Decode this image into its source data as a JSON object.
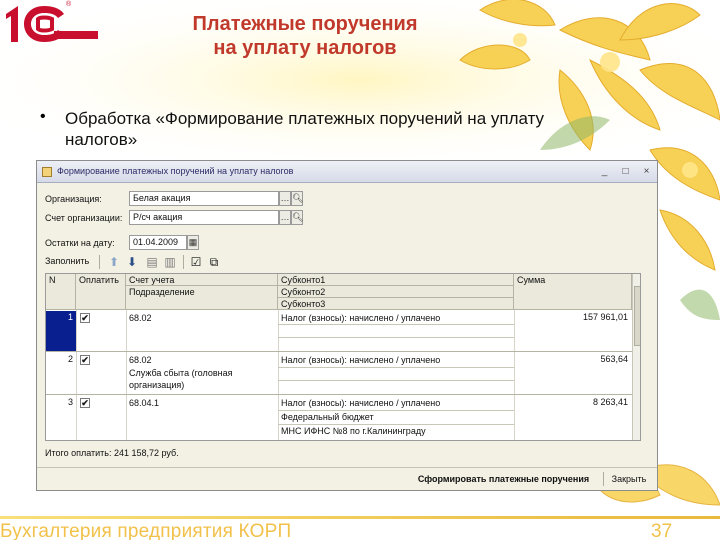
{
  "slide": {
    "title_line1": "Платежные поручения",
    "title_line2": "на уплату налогов",
    "bullet": "Обработка «Формирование платежных поручений на уплату налогов»",
    "footer": "Бухгалтерия предприятия КОРП",
    "page_number": "37",
    "logo_text": "1С",
    "logo_mark": "®"
  },
  "window": {
    "title": "Формирование платежных поручений на уплату налогов",
    "controls": [
      "_",
      "□",
      "×"
    ],
    "organization_label": "Организация:",
    "organization_value": "Белая акация",
    "account_label": "Счет организации:",
    "account_value": "Р/сч акация",
    "balance_label": "Остатки на дату:",
    "balance_value": "01.04.2009",
    "fill_button": "Заполнить",
    "columns": {
      "n": "N",
      "pay": "Оплатить",
      "account": "Счет учета",
      "division": "Подразделение",
      "sub1": "Субконто1",
      "sub2": "Субконто2",
      "sub3": "Субконто3",
      "sum": "Сумма"
    },
    "rows": [
      {
        "n": "1",
        "checked": true,
        "account": "68.02",
        "division": "",
        "sub1": "Налог (взносы): начислено / уплачено",
        "sub2": "",
        "sub3": "",
        "sum": "157 961,01"
      },
      {
        "n": "2",
        "checked": true,
        "account": "68.02",
        "division": "Служба сбыта (головная организация)",
        "sub1": "Налог (взносы): начислено / уплачено",
        "sub2": "",
        "sub3": "",
        "sum": "563,64"
      },
      {
        "n": "3",
        "checked": true,
        "account": "68.04.1",
        "division": "",
        "sub1": "Налог (взносы): начислено / уплачено",
        "sub2": "Федеральный бюджет",
        "sub3": "МНС ИФНС №8 по г.Калининграду",
        "sum": "8 263,41"
      }
    ],
    "total": "Итого оплатить: 241 158,72 руб.",
    "generate_button": "Сформировать платежные поручения",
    "close_button": "Закрыть"
  },
  "colors": {
    "title": "#c0392b",
    "logo": "#c8102e",
    "footer": "#f2c14a",
    "selection": "#0a1f8f"
  }
}
